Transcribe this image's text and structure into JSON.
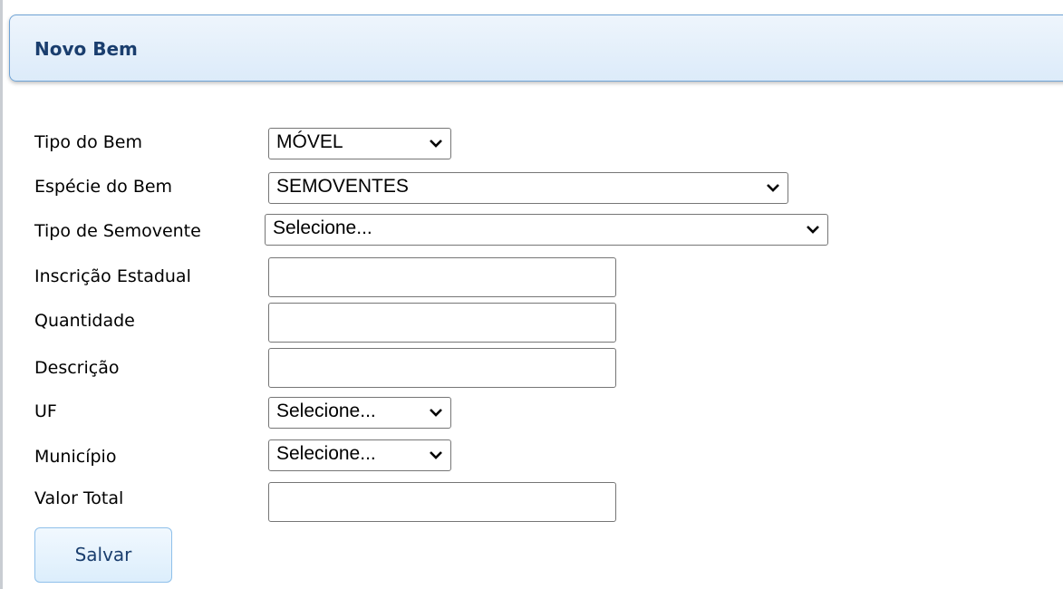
{
  "header": {
    "title": "Novo Bem"
  },
  "form": {
    "tipo_bem": {
      "label": "Tipo do Bem",
      "value": "MÓVEL"
    },
    "especie_bem": {
      "label": "Espécie do Bem",
      "value": "SEMOVENTES"
    },
    "tipo_semovente": {
      "label": "Tipo de Semovente",
      "value": "Selecione..."
    },
    "inscricao_estadual": {
      "label": "Inscrição Estadual",
      "value": ""
    },
    "quantidade": {
      "label": "Quantidade",
      "value": ""
    },
    "descricao": {
      "label": "Descrição",
      "value": ""
    },
    "uf": {
      "label": "UF",
      "value": "Selecione..."
    },
    "municipio": {
      "label": "Município",
      "value": "Selecione..."
    },
    "valor_total": {
      "label": "Valor Total",
      "value": ""
    }
  },
  "actions": {
    "save_label": "Salvar"
  },
  "icons": {
    "dropdown": "chevron-down-icon"
  }
}
